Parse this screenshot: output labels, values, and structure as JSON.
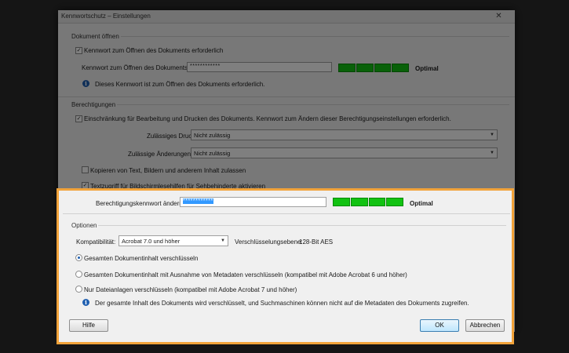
{
  "dialog": {
    "title": "Kennwortschutz – Einstellungen",
    "close_glyph": "✕"
  },
  "open_section": {
    "title": "Dokument öffnen",
    "require_password_label": "Kennwort zum Öffnen des Dokuments erforderlich",
    "require_password_checked": true,
    "password_label": "Kennwort zum Öffnen des Dokuments:",
    "password_value": "************",
    "strength": "Optimal",
    "info_text": "Dieses Kennwort ist zum Öffnen des Dokuments erforderlich."
  },
  "permissions_section": {
    "title": "Berechtigungen",
    "restrict_label": "Einschränkung für Bearbeitung und Drucken des Dokuments. Kennwort zum Ändern dieser Berechtigungseinstellungen erforderlich.",
    "restrict_checked": true,
    "printing_label": "Zulässiges Drucken:",
    "printing_value": "Nicht zulässig",
    "changes_label": "Zulässige Änderungen:",
    "changes_value": "Nicht zulässig",
    "copy_label": "Kopieren von Text, Bildern und anderem Inhalt zulassen",
    "copy_checked": false,
    "accessibility_label": "Textzugriff für Bildschirmlesehilfen für Sehbehinderte aktivieren",
    "accessibility_checked": true,
    "perm_password_label": "Berechtigungskennwort ändern:",
    "perm_password_value": "************",
    "strength": "Optimal"
  },
  "options_section": {
    "title": "Optionen",
    "compat_label": "Kompatibilität:",
    "compat_value": "Acrobat 7.0 und höher",
    "encryption_label": "Verschlüsselungsebene:",
    "encryption_value": "128-Bit AES",
    "radio_all": "Gesamten Dokumentinhalt verschlüsseln",
    "radio_except_meta": "Gesamten Dokumentinhalt mit Ausnahme von Metadaten verschlüsseln (kompatibel mit Adobe Acrobat 6 und höher)",
    "radio_attachments": "Nur Dateianlagen verschlüsseln (kompatibel mit Adobe Acrobat 7 und höher)",
    "selected": "radio_all",
    "info_text": "Der gesamte Inhalt des Dokuments wird verschlüsselt, und Suchmaschinen können nicht auf die Metadaten des Dokuments zugreifen."
  },
  "buttons": {
    "help": "Hilfe",
    "ok": "OK",
    "cancel": "Abbrechen"
  },
  "colors": {
    "accent_highlight": "#f2a33a",
    "strength_green": "#12c212",
    "info_blue": "#1e5fb0"
  }
}
